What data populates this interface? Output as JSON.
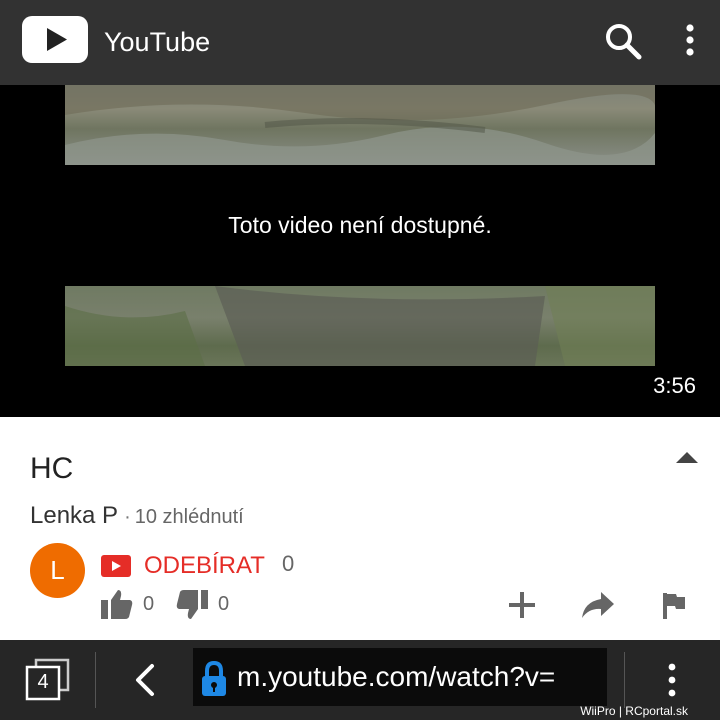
{
  "appbar": {
    "title": "YouTube",
    "logo_icon": "youtube-play-icon",
    "search_icon": "search-icon",
    "menu_icon": "more-vertical-icon"
  },
  "video": {
    "message": "Toto video není dostupné.",
    "duration": "3:56"
  },
  "info": {
    "title": "HC",
    "channel": "Lenka P",
    "separator": "·",
    "views": "10 zhlédnutí",
    "avatar_letter": "L",
    "subscribe_label": "ODEBÍRAT",
    "subscriber_count": "0",
    "likes": "0",
    "dislikes": "0",
    "colors": {
      "avatar": "#ef6c00",
      "subscribe": "#e52d27"
    }
  },
  "browser": {
    "tab_count": "4",
    "url": "m.youtube.com/watch?v=",
    "watermark": "WiiPro | RCportal.sk"
  }
}
